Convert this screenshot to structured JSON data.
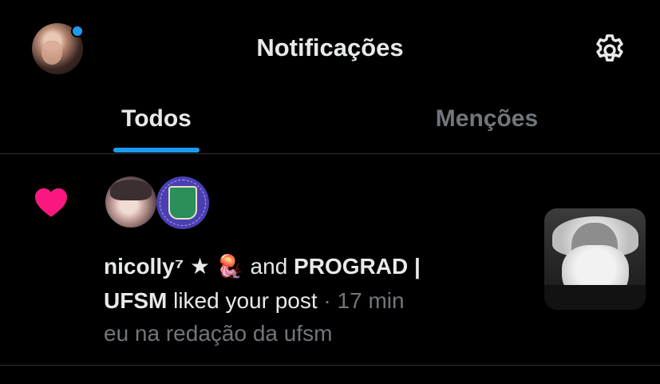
{
  "header": {
    "title": "Notificações",
    "settings_icon": "gear-icon",
    "avatar_has_unread_dot": true,
    "accent_color": "#1d9bf0"
  },
  "tabs": [
    {
      "label": "Todos",
      "active": true
    },
    {
      "label": "Menções",
      "active": false
    }
  ],
  "notification": {
    "icon": "heart-icon",
    "icon_color": "#f91880",
    "user1": "nicolly⁷ ★ 🪼",
    "connector": " and ",
    "user2": "PROGRAD | UFSM",
    "action": " liked your post",
    "separator": " · ",
    "time": "17 min",
    "post_snippet": "eu na redação da ufsm"
  }
}
